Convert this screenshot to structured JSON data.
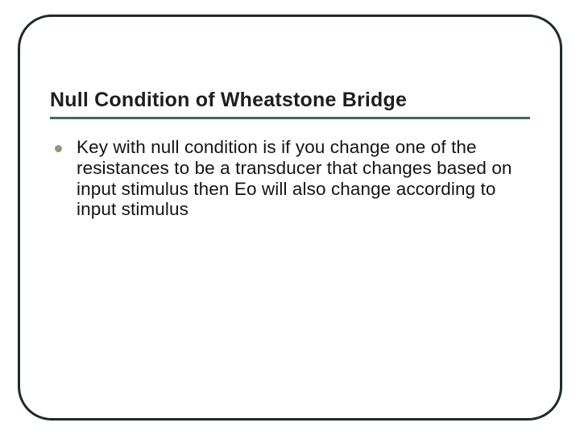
{
  "slide": {
    "title": "Null Condition of Wheatstone Bridge",
    "bullets": [
      "Key with null condition is if you change one of the resistances to be a transducer that changes based on input stimulus then Eo will also change according to input stimulus"
    ]
  },
  "colors": {
    "frame_border": "#1f2a2a",
    "title_underline": "#3a6a5a",
    "bullet": "#8a9a7a"
  }
}
